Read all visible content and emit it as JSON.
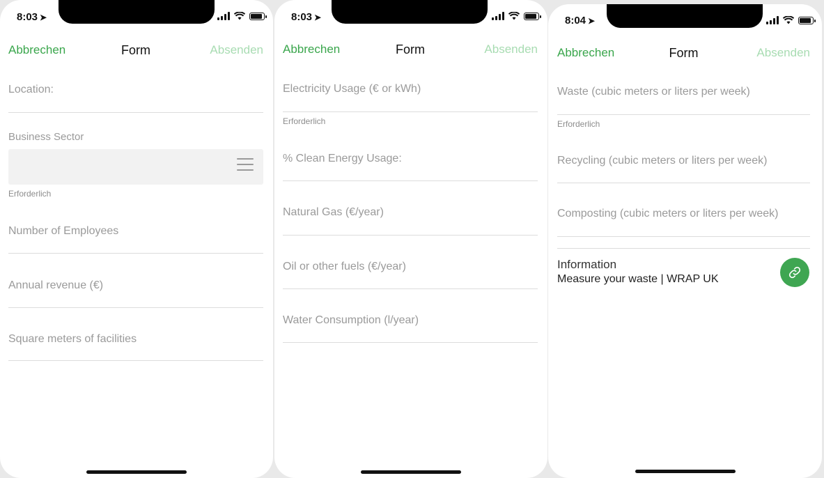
{
  "status": {
    "time1": "8:03",
    "time2": "8:03",
    "time3": "8:04"
  },
  "nav": {
    "cancel": "Abbrechen",
    "title": "Form",
    "send": "Absenden"
  },
  "required_text": "Erforderlich",
  "screen1": {
    "location": "Location:",
    "business_sector": "Business Sector",
    "employees": "Number of Employees",
    "revenue": "Annual revenue (€)",
    "square_meters": "Square meters of facilities"
  },
  "screen2": {
    "electricity": "Electricity Usage (€ or kWh)",
    "clean_energy": "% Clean Energy Usage:",
    "natural_gas": "Natural Gas (€/year)",
    "oil": "Oil or other fuels (€/year)",
    "water": "Water Consumption (l/year)"
  },
  "screen3": {
    "waste": "Waste (cubic meters or liters per week)",
    "recycling": "Recycling (cubic meters or liters per week)",
    "composting": "Composting (cubic meters or liters per week)",
    "info_label": "Information",
    "info_link": "Measure your waste | WRAP UK"
  },
  "icons": {
    "link": "link-icon",
    "menu": "menu-icon",
    "location_arrow": "location-arrow-icon"
  },
  "colors": {
    "accent": "#3aa64c",
    "accent_disabled": "#a8dcb2",
    "placeholder": "#9a9a9a"
  }
}
